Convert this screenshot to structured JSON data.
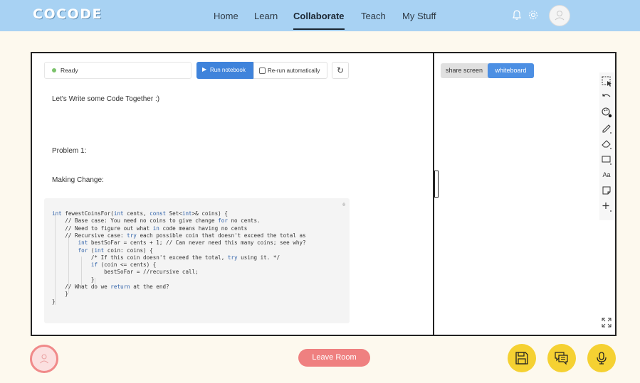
{
  "app": {
    "logo": "COCODE"
  },
  "nav": {
    "items": [
      {
        "label": "Home"
      },
      {
        "label": "Learn"
      },
      {
        "label": "Collaborate",
        "active": true
      },
      {
        "label": "Teach"
      },
      {
        "label": "My Stuff"
      }
    ]
  },
  "notebook": {
    "status": "Ready",
    "run_label": "Run notebook",
    "rerun_label": "Re-run automatically",
    "rerun_checked": false,
    "markdown": [
      "Let's Write some Code Together :)",
      "Problem 1:",
      "Making Change:"
    ],
    "cell_number": "0",
    "code_lines": [
      "int fewestCoinsFor(int cents, const Set<int>& coins) {",
      "    // Base case: You need no coins to give change for no cents.",
      "    // Need to figure out what in code means having no cents",
      "    // Recursive case: try each possible coin that doesn't exceed the total as",
      "        int bestSoFar = cents + 1; // Can never need this many coins; see why?",
      "        for (int coin: coins) {",
      "            /* If this coin doesn't exceed the total, try using it. */",
      "            if (coin <= cents) {",
      "                bestSoFar = //recursive call;",
      "            }",
      "    // What do we return at the end?",
      "    }",
      "}"
    ]
  },
  "whiteboard": {
    "tabs": [
      {
        "label": "share screen"
      },
      {
        "label": "whiteboard",
        "active": true
      }
    ],
    "tools": [
      {
        "icon": "select-icon"
      },
      {
        "icon": "undo-icon"
      },
      {
        "icon": "palette-icon"
      },
      {
        "icon": "pencil-icon"
      },
      {
        "icon": "eraser-icon"
      },
      {
        "icon": "rectangle-icon"
      },
      {
        "label": "Aa",
        "icon": "text-icon"
      },
      {
        "icon": "sticky-note-icon"
      },
      {
        "icon": "plus-icon"
      }
    ]
  },
  "footer": {
    "leave_label": "Leave Room"
  },
  "colors": {
    "nav_bg": "#a8d2f3",
    "accent_blue": "#3f83db",
    "leave_red": "#ef8080",
    "action_yellow": "#f5d132",
    "page_bg": "#fdf9ee"
  }
}
